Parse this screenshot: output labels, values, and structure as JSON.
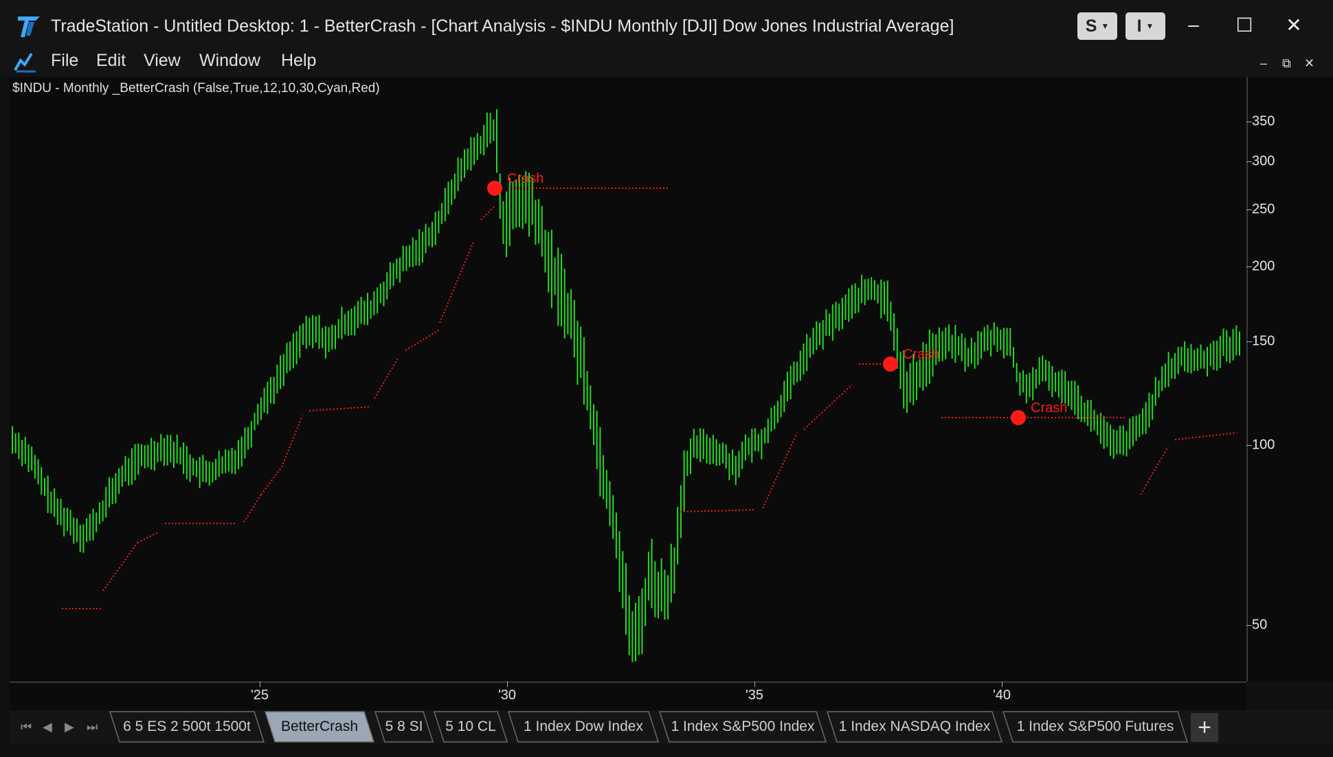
{
  "window": {
    "title": "TradeStation  - Untitled Desktop: 1 - BetterCrash - [Chart Analysis - $INDU Monthly [DJI] Dow Jones Industrial Average]",
    "btn_s": "S",
    "btn_i": "I",
    "minimize": "–",
    "maximize": "☐",
    "close": "✕"
  },
  "menu": {
    "items": [
      "File",
      "Edit",
      "View",
      "Window",
      "Help"
    ],
    "mdi_minimize": "–",
    "mdi_restore": "⧉",
    "mdi_close": "✕"
  },
  "chart": {
    "study_label": "$INDU - Monthly  _BetterCrash (False,True,12,10,30,Cyan,Red)",
    "y_ticks": [
      "350",
      "300",
      "250",
      "200",
      "150",
      "100",
      "50"
    ],
    "x_ticks": [
      "'25",
      "'30",
      "'35",
      "'40"
    ],
    "crash_label": "Crash",
    "colors": {
      "bar": "#22dd22",
      "stop": "#ff1a1a",
      "crash": "#ff1a1a",
      "background": "#0b0b0b"
    }
  },
  "chart_data": {
    "type": "ohlc",
    "y_scale": "log",
    "y_ticks": [
      350,
      300,
      250,
      200,
      150,
      100,
      50
    ],
    "x_ticks": [
      "'25",
      "'30",
      "'35",
      "'40"
    ],
    "crash_markers": [
      {
        "label": "Crash",
        "price": 270
      },
      {
        "label": "Crash",
        "price": 138
      },
      {
        "label": "Crash",
        "price": 112
      }
    ]
  },
  "tabs": [
    {
      "label": "6 5 ES 2 500t 1500t",
      "active": false
    },
    {
      "label": "BetterCrash",
      "active": true
    },
    {
      "label": "5 8 SI",
      "active": false
    },
    {
      "label": "5 10 CL",
      "active": false
    },
    {
      "label": "1 Index Dow Index",
      "active": false
    },
    {
      "label": "1 Index S&P500 Index",
      "active": false
    },
    {
      "label": "1 Index NASDAQ Index",
      "active": false
    },
    {
      "label": "1 Index S&P500 Futures",
      "active": false
    }
  ],
  "tab_add": "+"
}
